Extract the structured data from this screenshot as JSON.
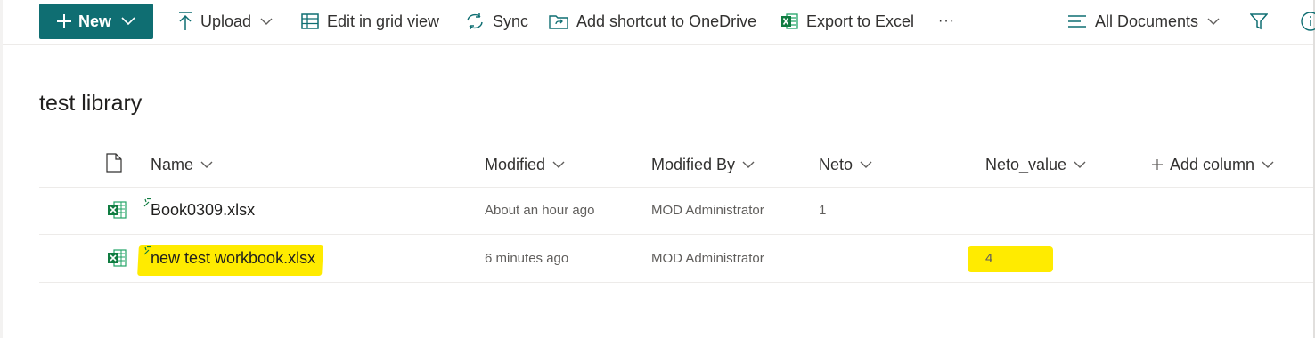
{
  "toolbar": {
    "new_label": "New",
    "upload_label": "Upload",
    "grid_label": "Edit in grid view",
    "sync_label": "Sync",
    "shortcut_label": "Add shortcut to OneDrive",
    "export_label": "Export to Excel",
    "more_label": "···",
    "view_label": "All Documents",
    "accent": "#0f6e72"
  },
  "library": {
    "title": "test library"
  },
  "columns": {
    "name": "Name",
    "modified": "Modified",
    "modified_by": "Modified By",
    "neto": "Neto",
    "neto_value": "Neto_value",
    "add": "Add column"
  },
  "rows": [
    {
      "name": "Book0309.xlsx",
      "modified": "About an hour ago",
      "modified_by": "MOD Administrator",
      "neto": "1",
      "neto_value": ""
    },
    {
      "name": "new test workbook.xlsx",
      "modified": "6 minutes ago",
      "modified_by": "MOD Administrator",
      "neto": "",
      "neto_value": "4"
    }
  ],
  "highlight_color": "#ffeb00"
}
